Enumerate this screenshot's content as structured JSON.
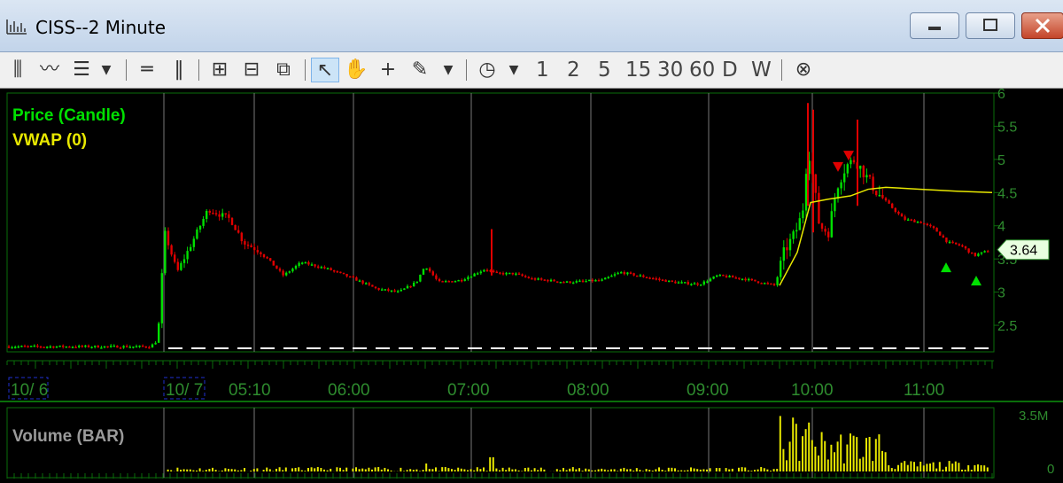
{
  "window": {
    "title": "CISS--2 Minute"
  },
  "toolbar": {
    "timeframes": [
      "1",
      "2",
      "5",
      "15",
      "30",
      "60",
      "D",
      "W"
    ]
  },
  "colors": {
    "up": "#00e000",
    "down": "#e00000",
    "vwap": "#e8e800",
    "grid": "#0a6e0a",
    "axis_text": "#2e8b2e",
    "volume": "#e8e800",
    "baseline": "#ffffff"
  },
  "chart_data": [
    {
      "type": "candlestick",
      "legend": [
        "Price (Candle)",
        "VWAP (0)"
      ],
      "ylim": [
        2.1,
        6.0
      ],
      "yticks": [
        "6",
        "5.5",
        "5",
        "4.5",
        "4",
        "3.5",
        "3",
        "2.5"
      ],
      "xticks": [
        "10/ 6",
        "10/ 7",
        "05:10",
        "06:00",
        "07:00",
        "08:00",
        "09:00",
        "10:00",
        "11:00"
      ],
      "last_price": "3.64",
      "price_path": [
        [
          0,
          2.18
        ],
        [
          170,
          2.18
        ],
        [
          178,
          2.28
        ],
        [
          186,
          3.9
        ],
        [
          200,
          3.3
        ],
        [
          215,
          3.7
        ],
        [
          235,
          4.25
        ],
        [
          260,
          4.1
        ],
        [
          275,
          3.75
        ],
        [
          295,
          3.6
        ],
        [
          320,
          3.25
        ],
        [
          340,
          3.45
        ],
        [
          370,
          3.35
        ],
        [
          400,
          3.2
        ],
        [
          425,
          3.05
        ],
        [
          450,
          3.0
        ],
        [
          470,
          3.15
        ],
        [
          480,
          3.4
        ],
        [
          495,
          3.15
        ],
        [
          520,
          3.18
        ],
        [
          548,
          3.35
        ],
        [
          560,
          3.28
        ],
        [
          580,
          3.28
        ],
        [
          600,
          3.2
        ],
        [
          640,
          3.15
        ],
        [
          680,
          3.18
        ],
        [
          700,
          3.3
        ],
        [
          720,
          3.25
        ],
        [
          760,
          3.15
        ],
        [
          790,
          3.12
        ],
        [
          810,
          3.25
        ],
        [
          840,
          3.2
        ],
        [
          875,
          3.1
        ],
        [
          885,
          3.6
        ],
        [
          898,
          3.9
        ],
        [
          906,
          4.2
        ],
        [
          912,
          5.2
        ],
        [
          918,
          4.7
        ],
        [
          925,
          4.0
        ],
        [
          935,
          3.9
        ],
        [
          945,
          4.6
        ],
        [
          955,
          4.9
        ],
        [
          965,
          5.0
        ],
        [
          975,
          4.8
        ],
        [
          990,
          4.5
        ],
        [
          1005,
          4.3
        ],
        [
          1020,
          4.1
        ],
        [
          1040,
          4.05
        ],
        [
          1055,
          3.95
        ],
        [
          1070,
          3.75
        ],
        [
          1085,
          3.7
        ],
        [
          1100,
          3.55
        ],
        [
          1110,
          3.6
        ],
        [
          1120,
          3.64
        ]
      ],
      "vwap_path": [
        [
          880,
          3.1
        ],
        [
          900,
          3.6
        ],
        [
          915,
          4.35
        ],
        [
          935,
          4.4
        ],
        [
          960,
          4.45
        ],
        [
          980,
          4.55
        ],
        [
          1000,
          4.58
        ],
        [
          1040,
          4.55
        ],
        [
          1080,
          4.52
        ],
        [
          1120,
          4.5
        ]
      ],
      "big_wicks": [
        {
          "x": 555,
          "high": 3.95,
          "low": 3.25
        },
        {
          "x": 912,
          "high": 5.85,
          "low": 4.3
        },
        {
          "x": 918,
          "high": 5.75,
          "low": 3.9
        },
        {
          "x": 968,
          "high": 5.6,
          "low": 4.3
        }
      ],
      "buy_markers": [
        {
          "x": 1068,
          "price": 3.38
        },
        {
          "x": 1102,
          "price": 3.18
        }
      ],
      "sell_markers": [
        {
          "x": 946,
          "price": 4.88
        },
        {
          "x": 958,
          "price": 5.05
        }
      ]
    },
    {
      "type": "bar",
      "legend": [
        "Volume (BAR)"
      ],
      "ylim": [
        0,
        3.5
      ],
      "yticks": [
        "3.5M",
        "0"
      ]
    }
  ]
}
